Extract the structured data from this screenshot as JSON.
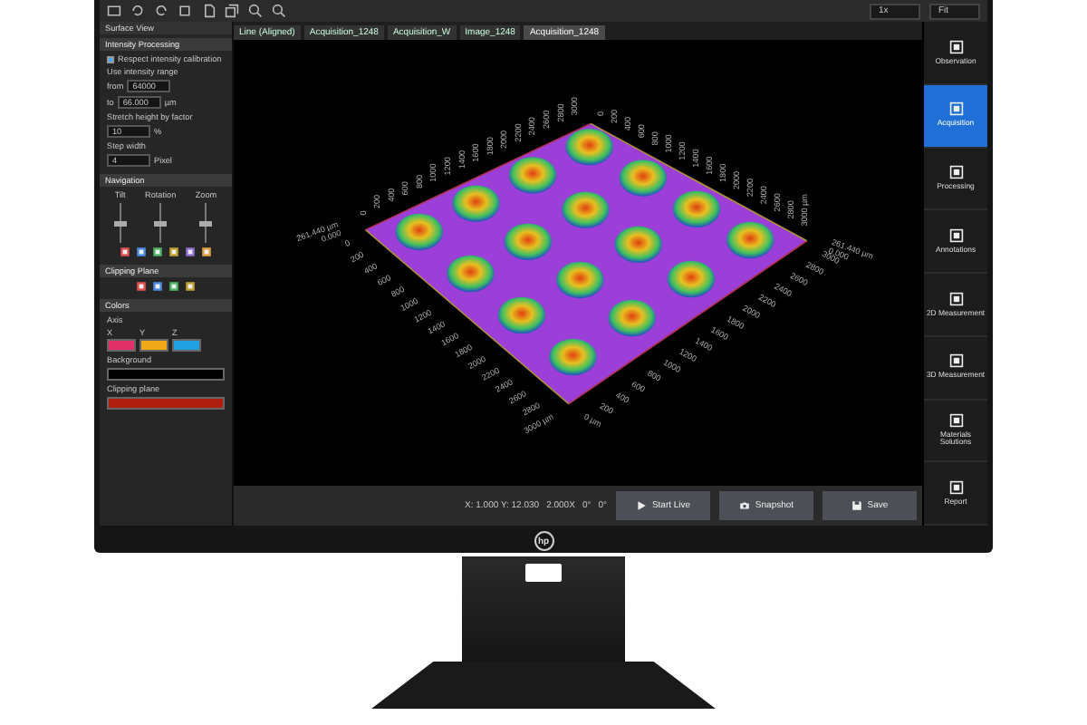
{
  "toolbar": {
    "zoom_factor": "1x",
    "zoom_mode": "Fit"
  },
  "tabs": [
    {
      "label": "Line (Aligned)",
      "selected": false
    },
    {
      "label": "Acquisition_1248",
      "selected": false
    },
    {
      "label": "Acquisition_W",
      "selected": false
    },
    {
      "label": "Image_1248",
      "selected": false
    },
    {
      "label": "Acquisition_1248",
      "selected": true
    }
  ],
  "panel": {
    "title": "Surface View",
    "sections": [
      {
        "title": "Intensity Processing",
        "rows": [
          {
            "kind": "checkbox",
            "label": "Respect intensity calibration",
            "checked": true
          },
          {
            "kind": "label",
            "label": "Use intensity range"
          },
          {
            "kind": "spin",
            "label": "from",
            "value": "64000"
          },
          {
            "kind": "spin",
            "label": "to",
            "value": "66.000",
            "unit": "µm"
          },
          {
            "kind": "label",
            "label": "Stretch height by factor"
          },
          {
            "kind": "spin",
            "value": "10",
            "unit": "%"
          },
          {
            "kind": "label",
            "label": "Step width"
          },
          {
            "kind": "spin",
            "value": "4",
            "unit": "Pixel"
          }
        ]
      },
      {
        "title": "Navigation",
        "rows": [
          {
            "kind": "sliders",
            "items": [
              {
                "label": "Tilt",
                "level": 0.5
              },
              {
                "label": "Rotation",
                "level": 0.5
              },
              {
                "label": "Zoom",
                "level": 0.5
              }
            ]
          },
          {
            "kind": "view_icons"
          }
        ]
      },
      {
        "title": "Clipping Plane",
        "rows": [
          {
            "kind": "clip_icons"
          }
        ]
      },
      {
        "title": "Colors",
        "rows": [
          {
            "kind": "label",
            "label": "Axis"
          },
          {
            "kind": "swatches",
            "items": [
              {
                "label": "X",
                "color": "#e0306a"
              },
              {
                "label": "Y",
                "color": "#f0a818"
              },
              {
                "label": "Z",
                "color": "#20a0e0"
              }
            ]
          },
          {
            "kind": "color",
            "label": "Background",
            "color": "#000000"
          },
          {
            "kind": "color",
            "label": "Clipping plane",
            "color": "#b01e10"
          }
        ]
      }
    ]
  },
  "plot": {
    "left_corner": [
      "261.440 µm",
      "0.000"
    ],
    "right_corner": [
      "261.440 µm",
      "0.000"
    ],
    "front_left_axis": [
      "0",
      "200",
      "400",
      "600",
      "800",
      "1000",
      "1200",
      "1400",
      "1600",
      "1800",
      "2000",
      "2200",
      "2400",
      "2600",
      "2800",
      "3000 µm"
    ],
    "front_right_axis": [
      "0 µm",
      "200",
      "400",
      "600",
      "800",
      "1000",
      "1200",
      "1400",
      "1600",
      "1800",
      "2000",
      "2200",
      "2400",
      "2600",
      "2800",
      "3000"
    ],
    "back_left_axis": [
      "0",
      "200",
      "400",
      "600",
      "800",
      "1000",
      "1200",
      "1400",
      "1600",
      "1800",
      "2000",
      "2200",
      "2400",
      "2600",
      "2800",
      "3000"
    ],
    "back_right_axis": [
      "0",
      "200",
      "400",
      "600",
      "800",
      "1000",
      "1200",
      "1400",
      "1600",
      "1800",
      "2000",
      "2200",
      "2400",
      "2600",
      "2800",
      "3000 µm"
    ]
  },
  "status": {
    "readouts": [
      "X: 1.000 Y: 12.030",
      "2.000X",
      "0°",
      "0°"
    ]
  },
  "actions": [
    {
      "label": "Start Live",
      "kind": "play"
    },
    {
      "label": "Snapshot",
      "kind": "camera"
    },
    {
      "label": "Save",
      "kind": "disk"
    }
  ],
  "rail": [
    {
      "label": "Observation",
      "selected": false
    },
    {
      "label": "Acquisition",
      "selected": true
    },
    {
      "label": "Processing",
      "selected": false
    },
    {
      "label": "Annotations",
      "selected": false
    },
    {
      "label": "2D Measurement",
      "selected": false
    },
    {
      "label": "3D Measurement",
      "selected": false
    },
    {
      "label": "Materials Solutions",
      "selected": false
    },
    {
      "label": "Report",
      "selected": false
    }
  ],
  "monitor": {
    "logo": "hp"
  }
}
